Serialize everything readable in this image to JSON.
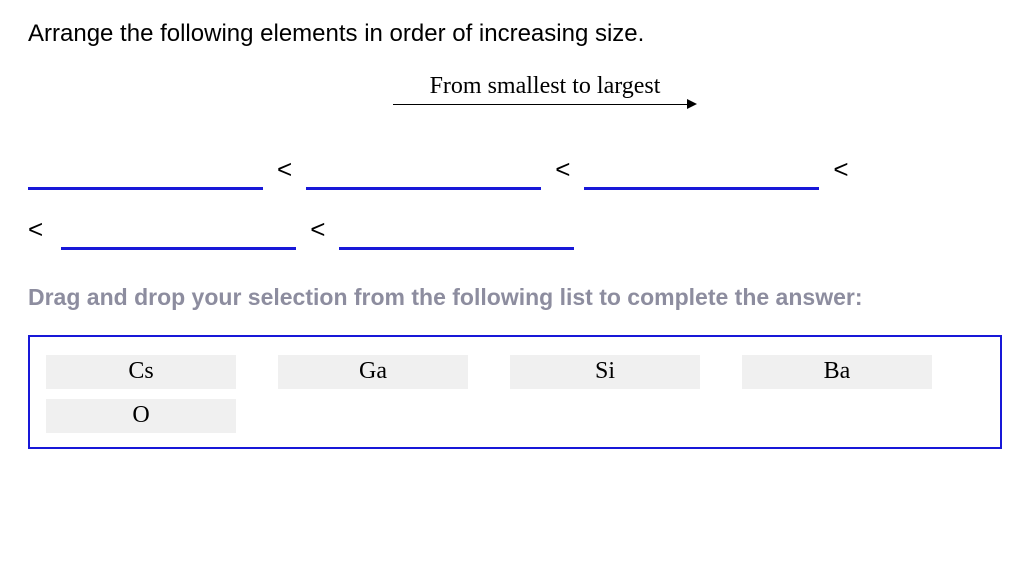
{
  "question": "Arrange the following elements in order of increasing size.",
  "direction_label": "From smallest to largest",
  "lt": "<",
  "instruction": "Drag and drop your selection from the following list to complete the answer:",
  "options": [
    "Cs",
    "Ga",
    "Si",
    "Ba",
    "O"
  ]
}
